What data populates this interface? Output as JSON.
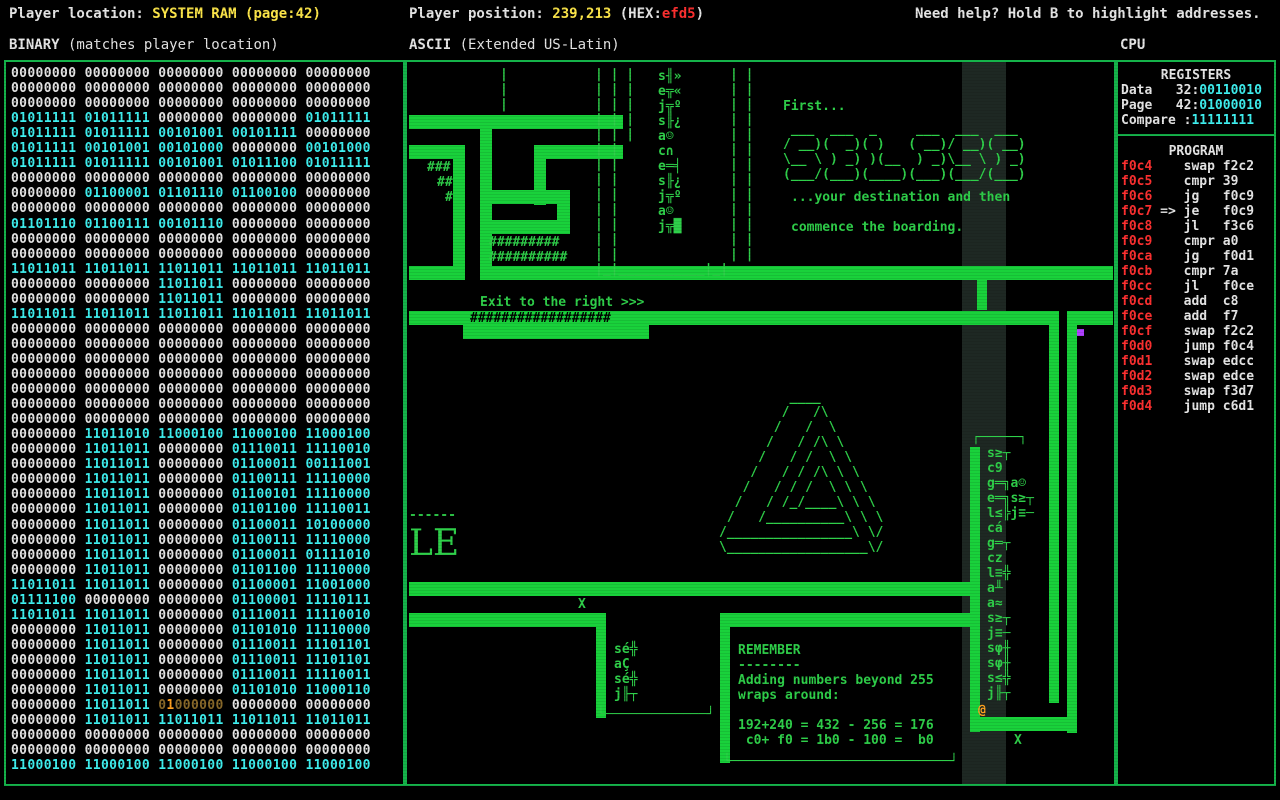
{
  "status": {
    "location_label": "Player location: ",
    "location_value": "SYSTEM RAM (page:42)",
    "position_label": "Player position: ",
    "position_value": "239,213",
    "hex_label": " (HEX:",
    "hex_value": "efd5",
    "hex_close": ")",
    "help": "Need help? Hold B to highlight addresses."
  },
  "sections": {
    "binary_title": "BINARY",
    "binary_sub": " (matches player location)",
    "ascii_title": "ASCII",
    "ascii_sub": " (Extended US-Latin)",
    "cpu_title": "CPU"
  },
  "binary_rows": [
    "00000000 00000000 00000000 00000000 00000000",
    "00000000 00000000 00000000 00000000 00000000",
    "00000000 00000000 00000000 00000000 00000000",
    "01011111 01011111 00000000 00000000 01011111",
    "01011111 01011111 00101001 00101111 00000000",
    "01011111 00101001 00101000 00000000 00101000",
    "01011111 01011111 00101001 01011100 01011111",
    "00000000 00000000 00000000 00000000 00000000",
    "00000000 01100001 01101110 01100100 00000000",
    "00000000 00000000 00000000 00000000 00000000",
    "01101110 01100111 00101110 00000000 00000000",
    "00000000 00000000 00000000 00000000 00000000",
    "00000000 00000000 00000000 00000000 00000000",
    "11011011 11011011 11011011 11011011 11011011",
    "00000000 00000000 11011011 00000000 00000000",
    "00000000 00000000 11011011 00000000 00000000",
    "11011011 11011011 11011011 11011011 11011011",
    "00000000 00000000 00000000 00000000 00000000",
    "00000000 00000000 00000000 00000000 00000000",
    "00000000 00000000 00000000 00000000 00000000",
    "00000000 00000000 00000000 00000000 00000000",
    "00000000 00000000 00000000 00000000 00000000",
    "00000000 00000000 00000000 00000000 00000000",
    "00000000 00000000 00000000 00000000 00000000",
    "00000000 11011010 11000100 11000100 11000100",
    "00000000 11011011 00000000 01110011 11110010",
    "00000000 11011011 00000000 01100011 00111001",
    "00000000 11011011 00000000 01100111 11110000",
    "00000000 11011011 00000000 01100101 11110000",
    "00000000 11011011 00000000 01101100 11110011",
    "00000000 11011011 00000000 01100011 10100000",
    "00000000 11011011 00000000 01100111 11110000",
    "00000000 11011011 00000000 01100011 01111010",
    "00000000 11011011 00000000 01101100 11110000",
    "11011011 11011011 00000000 01100001 11001000",
    "01111100 00000000 00000000 01100001 11110111",
    "11011011 11011011 00000000 01110011 11110010",
    "00000000 11011011 00000000 01101010 11110000",
    "00000000 11011011 00000000 01110011 11101101",
    "00000000 11011011 00000000 01110011 11101101",
    "00000000 11011011 00000000 01110011 11110011",
    "00000000 11011011 00000000 01101010 11000110",
    "00000000 11011011 01000000 00000000 00000000",
    "00000000 11011011 11011011 11011011 11011011",
    "00000000 00000000 00000000 00000000 00000000",
    "00000000 00000000 00000000 00000000 00000000",
    "11000100 11000100 11000100 11000100 11000100"
  ],
  "ascii": {
    "first": "First...",
    "banner": [
      " ___  ___  _     ___  ___  ___ ",
      "/ __)(  _)( )   ( __)/ __)( __)",
      "\\__ \\ ) _) )(__  ) _)\\__ \\ ) _)",
      "(___/(___)(____)(___)(___/(___)"
    ],
    "dest": "...your destination and then",
    "board": "commence the boarding.",
    "exit": "Exit to the right >>>",
    "hashes1": "#########",
    "hashes2": "##########",
    "hashbar": "##################",
    "hl1": "###",
    "hl2": "##",
    "hl3": "#",
    "col_top": [
      "s╢»",
      "e╦«",
      "j╦º",
      "s╟¿",
      "a☺",
      "c∩",
      "e═╡",
      "s╟¿",
      "j╦º",
      "a☺",
      "j╦█"
    ],
    "col_right": [
      "s≥┬",
      "c9",
      "g═╗a☺",
      "e═╗s≥┬",
      "l≤╠j≡─",
      "cá",
      "g═┬",
      "cz",
      "l≡╬",
      "a╨",
      "a≈",
      "s≥┬",
      "j≡─",
      "sφ╫",
      "sφ╫",
      "s≤╬",
      "j╟┬"
    ],
    "col_mid": [
      "sé╬",
      "aÇ",
      "sé╬",
      "j╟┬"
    ],
    "remember_title": "REMEMBER",
    "remember_rule": "--------",
    "remember_l1": "Adding numbers beyond 255",
    "remember_l2": "wraps around:",
    "remember_l3": "192+240 = 432 - 256 = 176",
    "remember_l4": " c0+ f0 = 1b0 - 100 =  b0",
    "x1": "X",
    "x2": "X",
    "at": "@",
    "le": "LE",
    "dash": "------",
    "triangle": [
      "         ____",
      "        /   /\\",
      "       /   /  \\",
      "      /   / /\\ \\",
      "     /   / /  \\ \\",
      "    /   / / /\\ \\ \\",
      "   /   / / /  \\ \\ \\",
      "  /   / /_/____\\ \\ \\",
      " /   /__________\\ \\ \\",
      "/________________\\ \\/",
      "\\__________________\\/"
    ]
  },
  "cpu": {
    "registers_title": "REGISTERS",
    "data_label": "Data   32:",
    "data_value": "00110010",
    "page_label": "Page   42:",
    "page_value": "01000010",
    "compare_label": "Compare :",
    "compare_value": "11111111",
    "program_title": "PROGRAM",
    "program": [
      {
        "addr": "f0c4",
        "ptr": "   ",
        "op": "swap",
        "arg": "f2c2"
      },
      {
        "addr": "f0c5",
        "ptr": "   ",
        "op": "cmpr",
        "arg": "39"
      },
      {
        "addr": "f0c6",
        "ptr": "   ",
        "op": "jg  ",
        "arg": "f0c9"
      },
      {
        "addr": "f0c7",
        "ptr": " =>",
        "op": "je  ",
        "arg": "f0c9"
      },
      {
        "addr": "f0c8",
        "ptr": "   ",
        "op": "jl  ",
        "arg": "f3c6"
      },
      {
        "addr": "f0c9",
        "ptr": "   ",
        "op": "cmpr",
        "arg": "a0"
      },
      {
        "addr": "f0ca",
        "ptr": "   ",
        "op": "jg  ",
        "arg": "f0d1"
      },
      {
        "addr": "f0cb",
        "ptr": "   ",
        "op": "cmpr",
        "arg": "7a"
      },
      {
        "addr": "f0cc",
        "ptr": "   ",
        "op": "jl  ",
        "arg": "f0ce"
      },
      {
        "addr": "f0cd",
        "ptr": "   ",
        "op": "add ",
        "arg": "c8"
      },
      {
        "addr": "f0ce",
        "ptr": "   ",
        "op": "add ",
        "arg": "f7"
      },
      {
        "addr": "f0cf",
        "ptr": "   ",
        "op": "swap",
        "arg": "f2c2"
      },
      {
        "addr": "f0d0",
        "ptr": "   ",
        "op": "jump",
        "arg": "f0c4"
      },
      {
        "addr": "f0d1",
        "ptr": "   ",
        "op": "swap",
        "arg": "edcc"
      },
      {
        "addr": "f0d2",
        "ptr": "   ",
        "op": "swap",
        "arg": "edce"
      },
      {
        "addr": "f0d3",
        "ptr": "   ",
        "op": "swap",
        "arg": "f3d7"
      },
      {
        "addr": "f0d4",
        "ptr": "   ",
        "op": "jump",
        "arg": "c6d1"
      }
    ]
  },
  "colors": {
    "wall": "#19d13b",
    "text_green": "#2fd04a",
    "cyan": "#3ff0f0",
    "address_red": "#ff3030",
    "yellow": "#ffe84a",
    "player": "#b040ff"
  }
}
